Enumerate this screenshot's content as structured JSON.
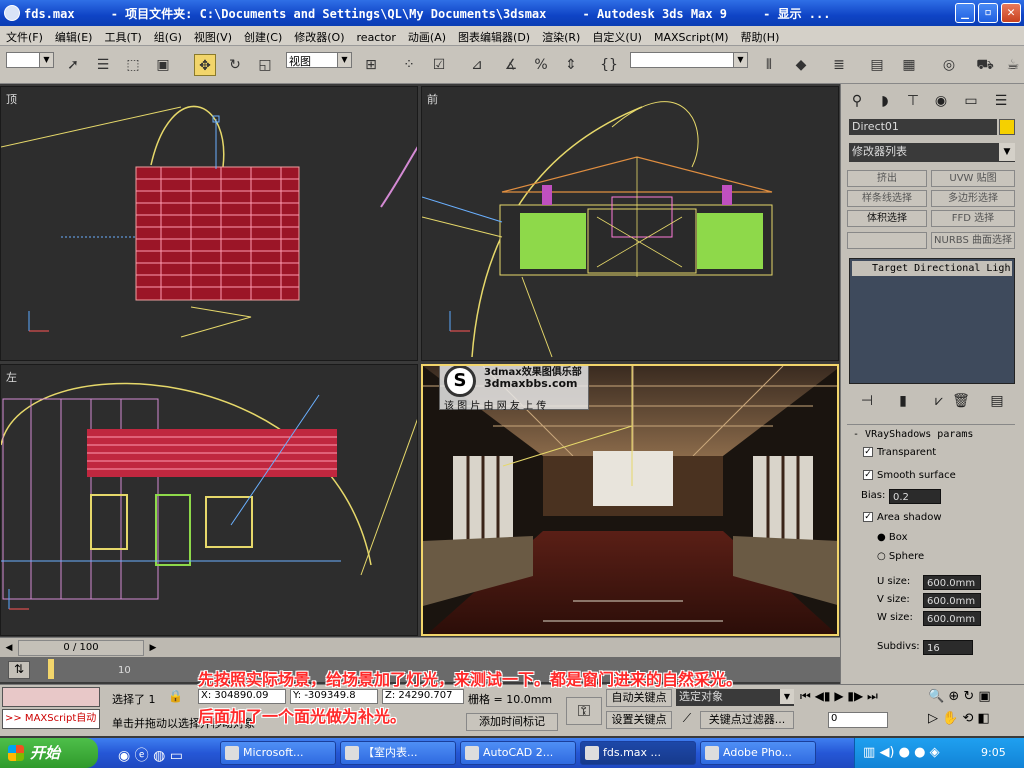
{
  "window": {
    "title": "fds.max     - 项目文件夹: C:\\Documents and Settings\\QL\\My Documents\\3dsmax     - Autodesk 3ds Max 9     - 显示 ...",
    "min": "_",
    "max": "▫",
    "close": "✕"
  },
  "menu": [
    "文件(F)",
    "编辑(E)",
    "工具(T)",
    "组(G)",
    "视图(V)",
    "创建(C)",
    "修改器(O)",
    "reactor",
    "动画(A)",
    "图表编辑器(D)",
    "渲染(R)",
    "自定义(U)",
    "MAXScript(M)",
    "帮助(H)"
  ],
  "toolbar": {
    "coord_combo": "视图",
    "select_filter": "",
    "named_selection": ""
  },
  "viewports": {
    "top": "顶",
    "front": "前",
    "left": "左",
    "persp": ""
  },
  "watermark": {
    "line1": "3dmax效果图俱乐部",
    "line2": "3dmaxbbs.com",
    "line3": "该 图 片 由 网 友 上 传"
  },
  "command_panel": {
    "object_name": "Direct01",
    "object_color": "#f5d000",
    "modifier_list": "修改器列表",
    "buttons": [
      "挤出",
      "UVW 贴图",
      "样条线选择",
      "多边形选择",
      "体积选择",
      "FFD 选择",
      "",
      "NURBS 曲面选择"
    ],
    "stack_item": "Target Directional Ligh",
    "rollout_title": "VRayShadows params",
    "transparent": "Transparent",
    "smooth_surface": "Smooth surface",
    "bias_label": "Bias:",
    "bias": "0.2",
    "area_shadow": "Area shadow",
    "box": "Box",
    "sphere": "Sphere",
    "u_size_label": "U size:",
    "u_size": "600.0mm",
    "v_size_label": "V size:",
    "v_size": "600.0mm",
    "w_size_label": "W size:",
    "w_size": "600.0mm",
    "subdivs_label": "Subdivs:",
    "subdivs": "16"
  },
  "timeline": {
    "frame": "0 / 100",
    "tick": "10"
  },
  "status": {
    "maxscript": ">> MAXScript自动",
    "selected": "选择了 1",
    "x": "X: 304890.09",
    "y": "Y: -309349.8",
    "z": "Z: 24290.707",
    "grid": "栅格 = 10.0mm",
    "prompt": "单击并拖动以选择并移动对象",
    "auto_key": "自动关键点",
    "set_key": "设置关键点",
    "add_time_tag": "添加时间标记",
    "selected_object": "选定对象",
    "key_filters": "关键点过滤器...",
    "frame_field": "0"
  },
  "overlay": {
    "line1": "先按照实际场景，给场景加了灯光，来测试一下。都是窗门进来的自然采光。",
    "line2": "后面加了一个面光做为补光。"
  },
  "taskbar": {
    "start": "开始",
    "tasks": [
      "Microsoft...",
      "【室内表...",
      "AutoCAD 2...",
      "fds.max  ...",
      "Adobe Pho..."
    ],
    "clock": "9:05"
  }
}
